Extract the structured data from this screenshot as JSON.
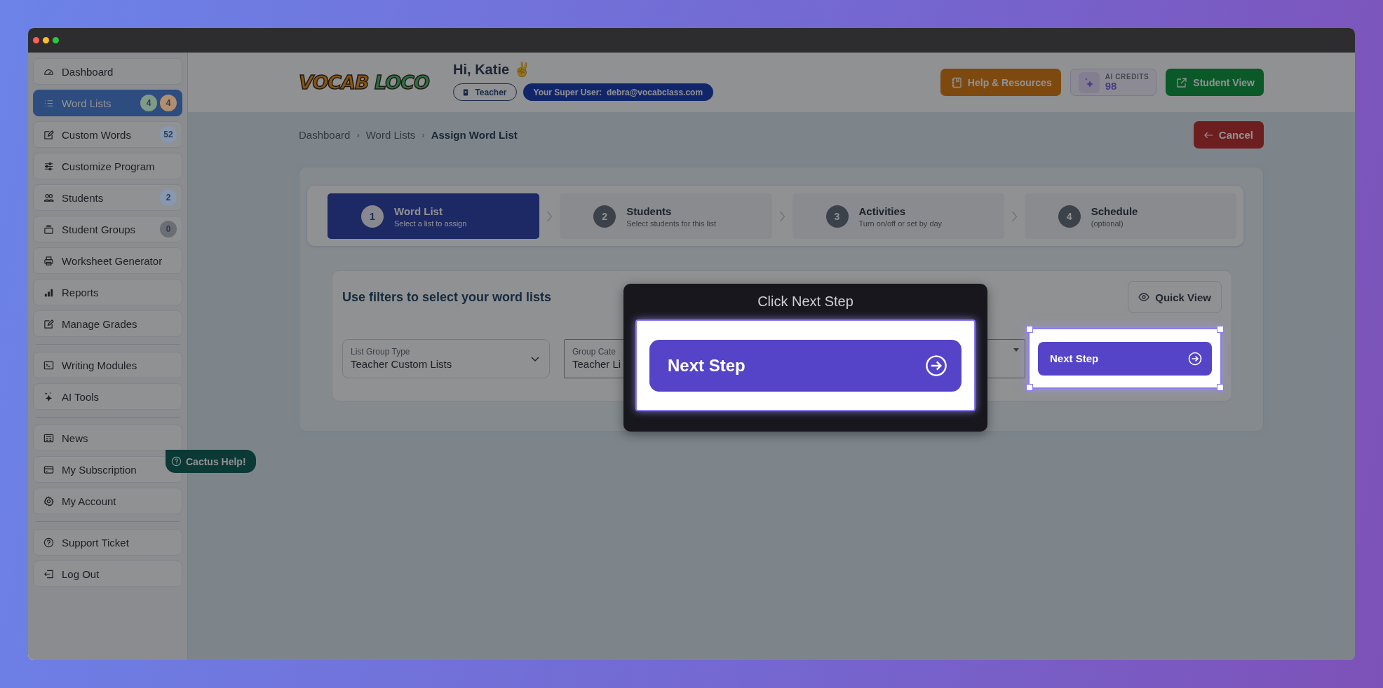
{
  "sidebar": {
    "groups": [
      [
        {
          "label": "Dashboard",
          "selected": false
        },
        {
          "label": "Word Lists",
          "selected": true,
          "badges": [
            {
              "text": "4",
              "color": "#7f9a86"
            },
            {
              "text": "4",
              "color": "#b08e6e"
            }
          ]
        },
        {
          "label": "Custom Words",
          "selected": false,
          "badges": [
            {
              "text": "52",
              "color": "#8798b0"
            }
          ]
        },
        {
          "label": "Customize Program",
          "selected": false
        },
        {
          "label": "Students",
          "selected": false,
          "badges": [
            {
              "text": "2",
              "color": "#8798b0"
            }
          ]
        },
        {
          "label": "Student Groups",
          "selected": false,
          "badges": [
            {
              "text": "0",
              "color": "#6b6f73"
            }
          ]
        },
        {
          "label": "Worksheet Generator",
          "selected": false
        },
        {
          "label": "Reports",
          "selected": false
        },
        {
          "label": "Manage Grades",
          "selected": false
        }
      ],
      [
        {
          "label": "Writing Modules",
          "selected": false
        },
        {
          "label": "AI Tools",
          "selected": false
        }
      ],
      [
        {
          "label": "News",
          "selected": false
        },
        {
          "label": "My Subscription",
          "selected": false
        },
        {
          "label": "My Account",
          "selected": false
        }
      ],
      [
        {
          "label": "Support Ticket",
          "selected": false
        },
        {
          "label": "Log Out",
          "selected": false
        }
      ]
    ]
  },
  "header": {
    "logo": [
      "VOCAB",
      "LOCO"
    ],
    "greeting": "Hi, Katie ✌",
    "role": "Teacher",
    "super_user": "Your Super User:  debra@vocabclass.com",
    "help_button": "Help & Resources",
    "ai_credits": {
      "label": "AI CREDITS",
      "value": "98"
    },
    "student_view_button": "Student View"
  },
  "breadcrumb": {
    "separator": "›",
    "items": [
      "Dashboard",
      "Word Lists",
      "Assign Word List"
    ]
  },
  "cancel_button": "Cancel",
  "steps": [
    {
      "number": "1",
      "title": "Word List",
      "subtitle": "Select a list to assign",
      "selected": true
    },
    {
      "number": "2",
      "title": "Students",
      "subtitle": "Select students for this list",
      "selected": false
    },
    {
      "number": "3",
      "title": "Activities",
      "subtitle": "Turn on/off or set by day",
      "selected": false
    },
    {
      "number": "4",
      "title": "Schedule",
      "subtitle": "(optional)",
      "selected": false
    }
  ],
  "filters": {
    "title": "Use filters to select your word lists",
    "quick_view_button": "Quick View",
    "fields": [
      {
        "label": "List Group Type",
        "value": "Teacher Custom Lists"
      },
      {
        "label": "Group Cate",
        "value": "Teacher Li"
      }
    ],
    "next_button": "Next Step"
  },
  "help_chip": "Cactus Help!",
  "tour_popup": {
    "title": "Click Next Step",
    "button": "Next Step"
  }
}
